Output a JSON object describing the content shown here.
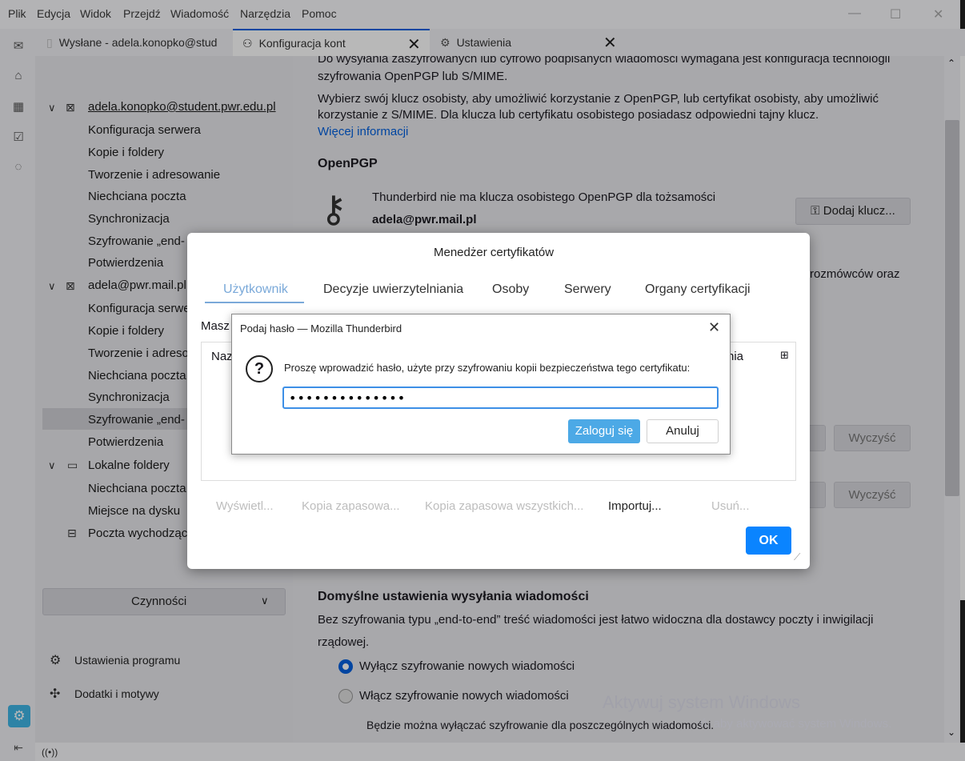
{
  "menu": [
    "Plik",
    "Edycja",
    "Widok",
    "Przejdź",
    "Wiadomość",
    "Narzędzia",
    "Pomoc"
  ],
  "tabs": {
    "t1": "Wysłane - adela.konopko@stud",
    "t2": "Konfiguracja kont",
    "t3": "Ustawienia"
  },
  "sidebar": {
    "account1": "adela.konopko@student.pwr.edu.pl",
    "account1_items": [
      "Konfiguracja serwera",
      "Kopie i foldery",
      "Tworzenie i adresowanie",
      "Niechciana poczta",
      "Synchronizacja",
      "Szyfrowanie „end-",
      "Potwierdzenia"
    ],
    "account2": "adela@pwr.mail.pl",
    "account2_items": [
      "Konfiguracja serwe",
      "Kopie i foldery",
      "Tworzenie i adreso",
      "Niechciana poczta",
      "Synchronizacja",
      "Szyfrowanie „end-",
      "Potwierdzenia"
    ],
    "local": "Lokalne foldery",
    "local_items": [
      "Niechciana poczta",
      "Miejsce na dysku"
    ],
    "outgoing": "Poczta wychodząc",
    "actions": "Czynności",
    "settings_link": "Ustawienia programu",
    "addons_link": "Dodatki i motywy"
  },
  "main": {
    "p1a": "Do wysyłania zaszyfrowanych lub cyfrowo podpisanych wiadomości wymagana jest konfiguracja technologii",
    "p1b": "szyfrowania OpenPGP lub S/MIME.",
    "p2a": "Wybierz swój klucz osobisty, aby umożliwić korzystanie z OpenPGP, lub certyfikat osobisty, aby umożliwić",
    "p2b": "korzystanie z S/MIME. Dla klucza lub certyfikatu osobistego posiadasz odpowiedni tajny klucz.",
    "more": "Więcej informacji",
    "openpgp": "OpenPGP",
    "nokey": "Thunderbird nie ma klucza osobistego OpenPGP dla tożsamości",
    "identity": "adela@pwr.mail.pl",
    "addkey": "Dodaj klucz...",
    "partial": "rozmówców oraz",
    "clear": "Wyczyść",
    "send_heading": "Domyślne ustawienia wysyłania wiadomości",
    "send_p1": "Bez szyfrowania typu „end-to-end” treść wiadomości jest łatwo widoczna dla dostawcy poczty i inwigilacji",
    "send_p2": "rządowej.",
    "radio_off": "Wyłącz szyfrowanie nowych wiadomości",
    "radio_on": "Włącz szyfrowanie nowych wiadomości",
    "note": "Będzie można wyłączać szyfrowanie dla poszczególnych wiadomości."
  },
  "certmgr": {
    "title": "Menedżer certyfikatów",
    "tabs": [
      "Użytkownik",
      "Decyzje uwierzytelniania",
      "Osoby",
      "Serwery",
      "Organy certyfikacji"
    ],
    "mas_label": "Masz",
    "col_name": "Naz",
    "col_last": "nia",
    "actions": [
      "Wyświetl...",
      "Kopia zapasowa...",
      "Kopia zapasowa wszystkich...",
      "Importuj...",
      "Usuń..."
    ],
    "ok": "OK"
  },
  "pwdialog": {
    "title": "Podaj hasło — Mozilla Thunderbird",
    "prompt": "Proszę wprowadzić hasło, użyte przy szyfrowaniu kopii bezpieczeństwa tego certyfikatu:",
    "value": "••••••••••••••",
    "login": "Zaloguj się",
    "cancel": "Anuluj"
  },
  "status": "((•))",
  "watermark": {
    "line1": "Aktywuj system Windows",
    "line2": "ń, aby aktywować system Windows."
  },
  "colors": {
    "accent": "#0060df",
    "ok": "#0a84ff",
    "login": "#4ca9e6"
  }
}
